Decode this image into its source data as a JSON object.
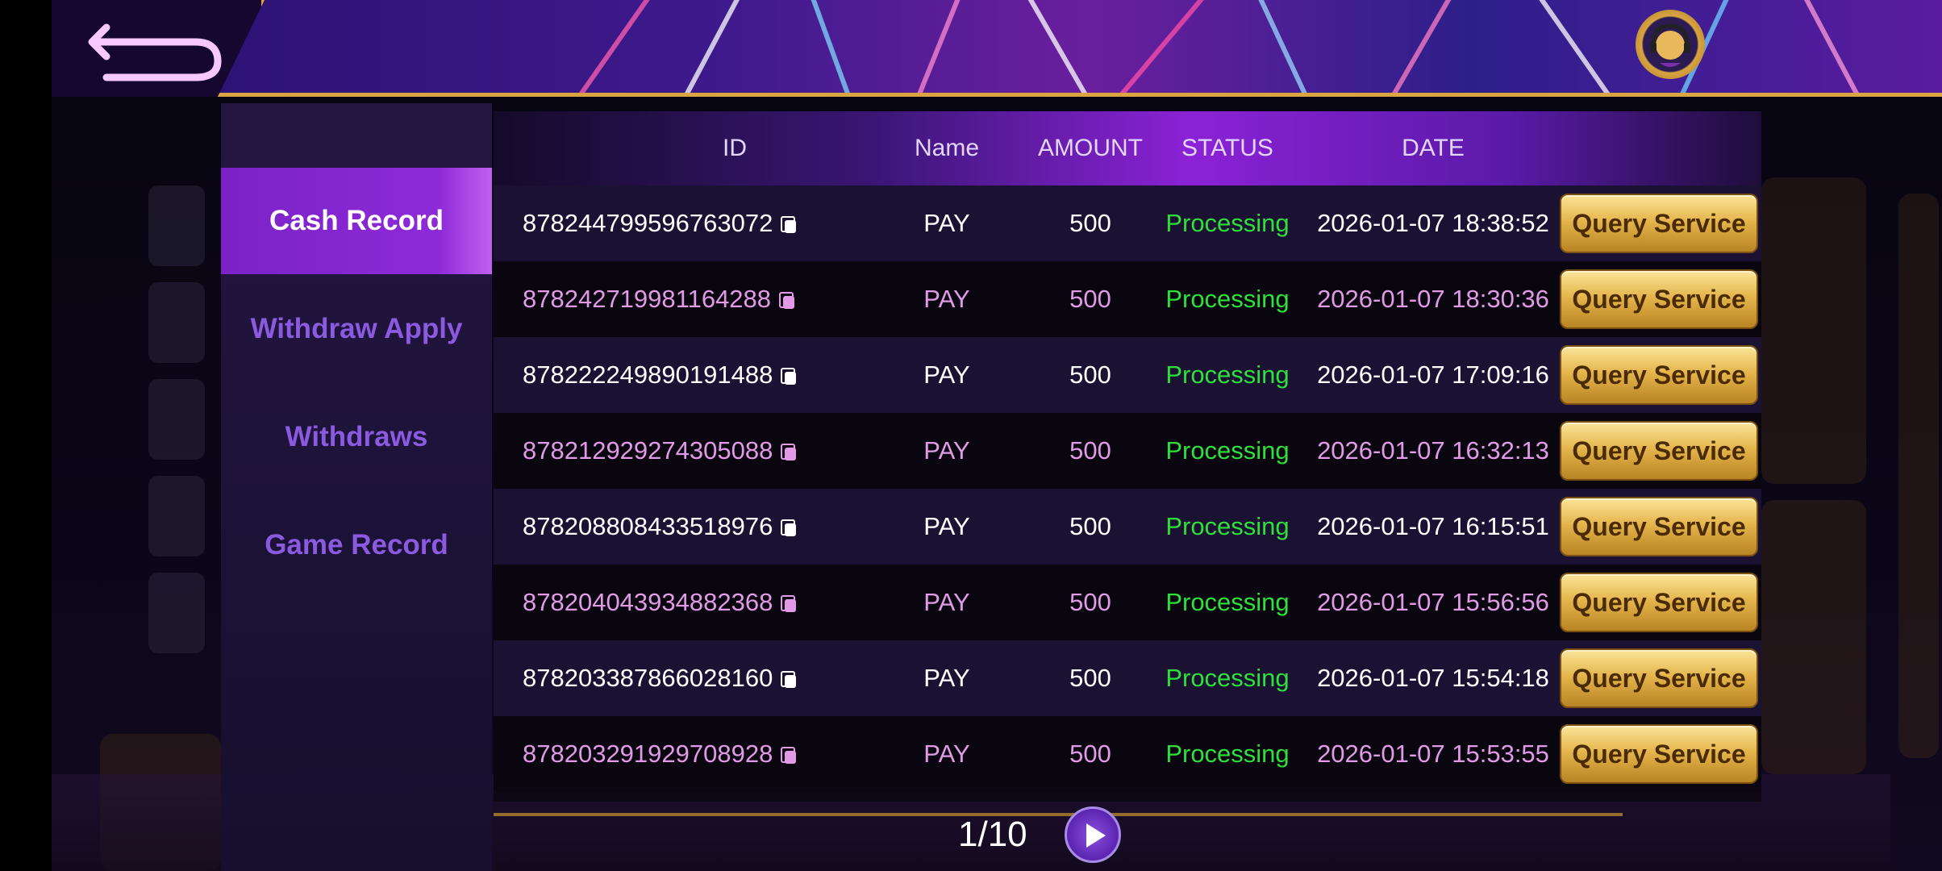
{
  "header": {
    "back_icon": "back-arrow-icon",
    "support_icon": "customer-service-icon"
  },
  "sidebar": {
    "items": [
      {
        "label": "Cash Record",
        "active": true
      },
      {
        "label": "Withdraw Apply",
        "active": false
      },
      {
        "label": "Withdraws",
        "active": false
      },
      {
        "label": "Game Record",
        "active": false
      }
    ]
  },
  "table": {
    "columns": [
      "ID",
      "Name",
      "AMOUNT",
      "STATUS",
      "DATE"
    ],
    "rows": [
      {
        "id": "878244799596763072",
        "name": "PAY",
        "amount": "500",
        "status": "Processing",
        "date": "2026-01-07 18:38:52"
      },
      {
        "id": "878242719981164288",
        "name": "PAY",
        "amount": "500",
        "status": "Processing",
        "date": "2026-01-07 18:30:36"
      },
      {
        "id": "878222249890191488",
        "name": "PAY",
        "amount": "500",
        "status": "Processing",
        "date": "2026-01-07 17:09:16"
      },
      {
        "id": "878212929274305088",
        "name": "PAY",
        "amount": "500",
        "status": "Processing",
        "date": "2026-01-07 16:32:13"
      },
      {
        "id": "878208808433518976",
        "name": "PAY",
        "amount": "500",
        "status": "Processing",
        "date": "2026-01-07 16:15:51"
      },
      {
        "id": "878204043934882368",
        "name": "PAY",
        "amount": "500",
        "status": "Processing",
        "date": "2026-01-07 15:56:56"
      },
      {
        "id": "878203387866028160",
        "name": "PAY",
        "amount": "500",
        "status": "Processing",
        "date": "2026-01-07 15:54:18"
      },
      {
        "id": "878203291929708928",
        "name": "PAY",
        "amount": "500",
        "status": "Processing",
        "date": "2026-01-07 15:53:55"
      }
    ],
    "action_label": "Query Service"
  },
  "pagination": {
    "label": "1/10",
    "next_icon": "play-next-icon"
  },
  "colors": {
    "odd_text": "#ffffff",
    "even_text": "#e29ae6",
    "status": "#2ee03a",
    "gold": "#d9a441",
    "accent_purple": "#8b22d6"
  }
}
